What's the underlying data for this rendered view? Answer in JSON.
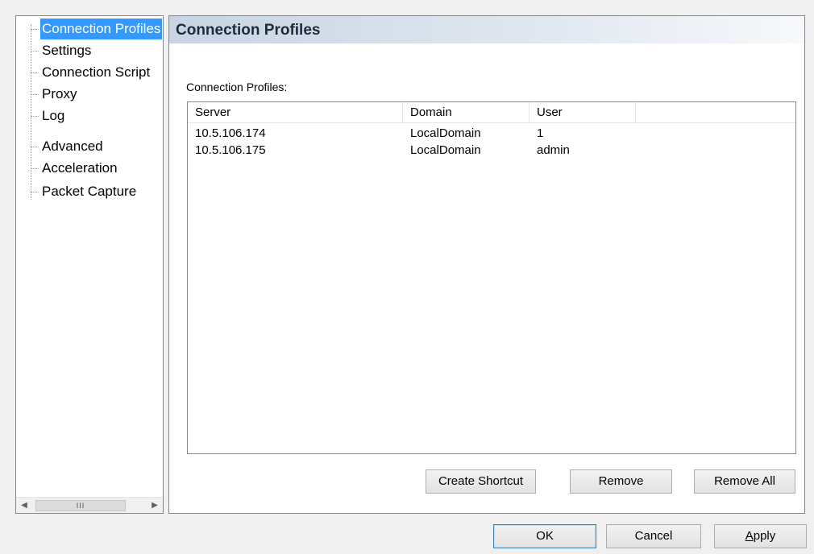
{
  "tree": {
    "items": [
      {
        "label": "Connection Profiles",
        "selected": true
      },
      {
        "label": "Settings"
      },
      {
        "label": "Connection Script"
      },
      {
        "label": "Proxy"
      },
      {
        "label": "Log"
      },
      {
        "label": "Advanced"
      },
      {
        "label": "Acceleration"
      },
      {
        "label": "Packet Capture"
      }
    ],
    "scrollbar_thumb_glyph": "III"
  },
  "content": {
    "title": "Connection Profiles",
    "list_caption": "Connection Profiles:",
    "columns": [
      "Server",
      "Domain",
      "User"
    ],
    "rows": [
      {
        "server": "10.5.106.174",
        "domain": "LocalDomain",
        "user": "1"
      },
      {
        "server": "10.5.106.175",
        "domain": "LocalDomain",
        "user": "admin"
      }
    ],
    "buttons": {
      "create_shortcut": "Create Shortcut",
      "remove": "Remove",
      "remove_all": "Remove All"
    }
  },
  "dialog_buttons": {
    "ok": "OK",
    "cancel": "Cancel",
    "apply_mnemonic": "A",
    "apply_rest": "pply"
  },
  "colors": {
    "selection": "#3399ff",
    "header_gradient_start": "#c8d4e3",
    "title_text": "#1e2b3c"
  }
}
